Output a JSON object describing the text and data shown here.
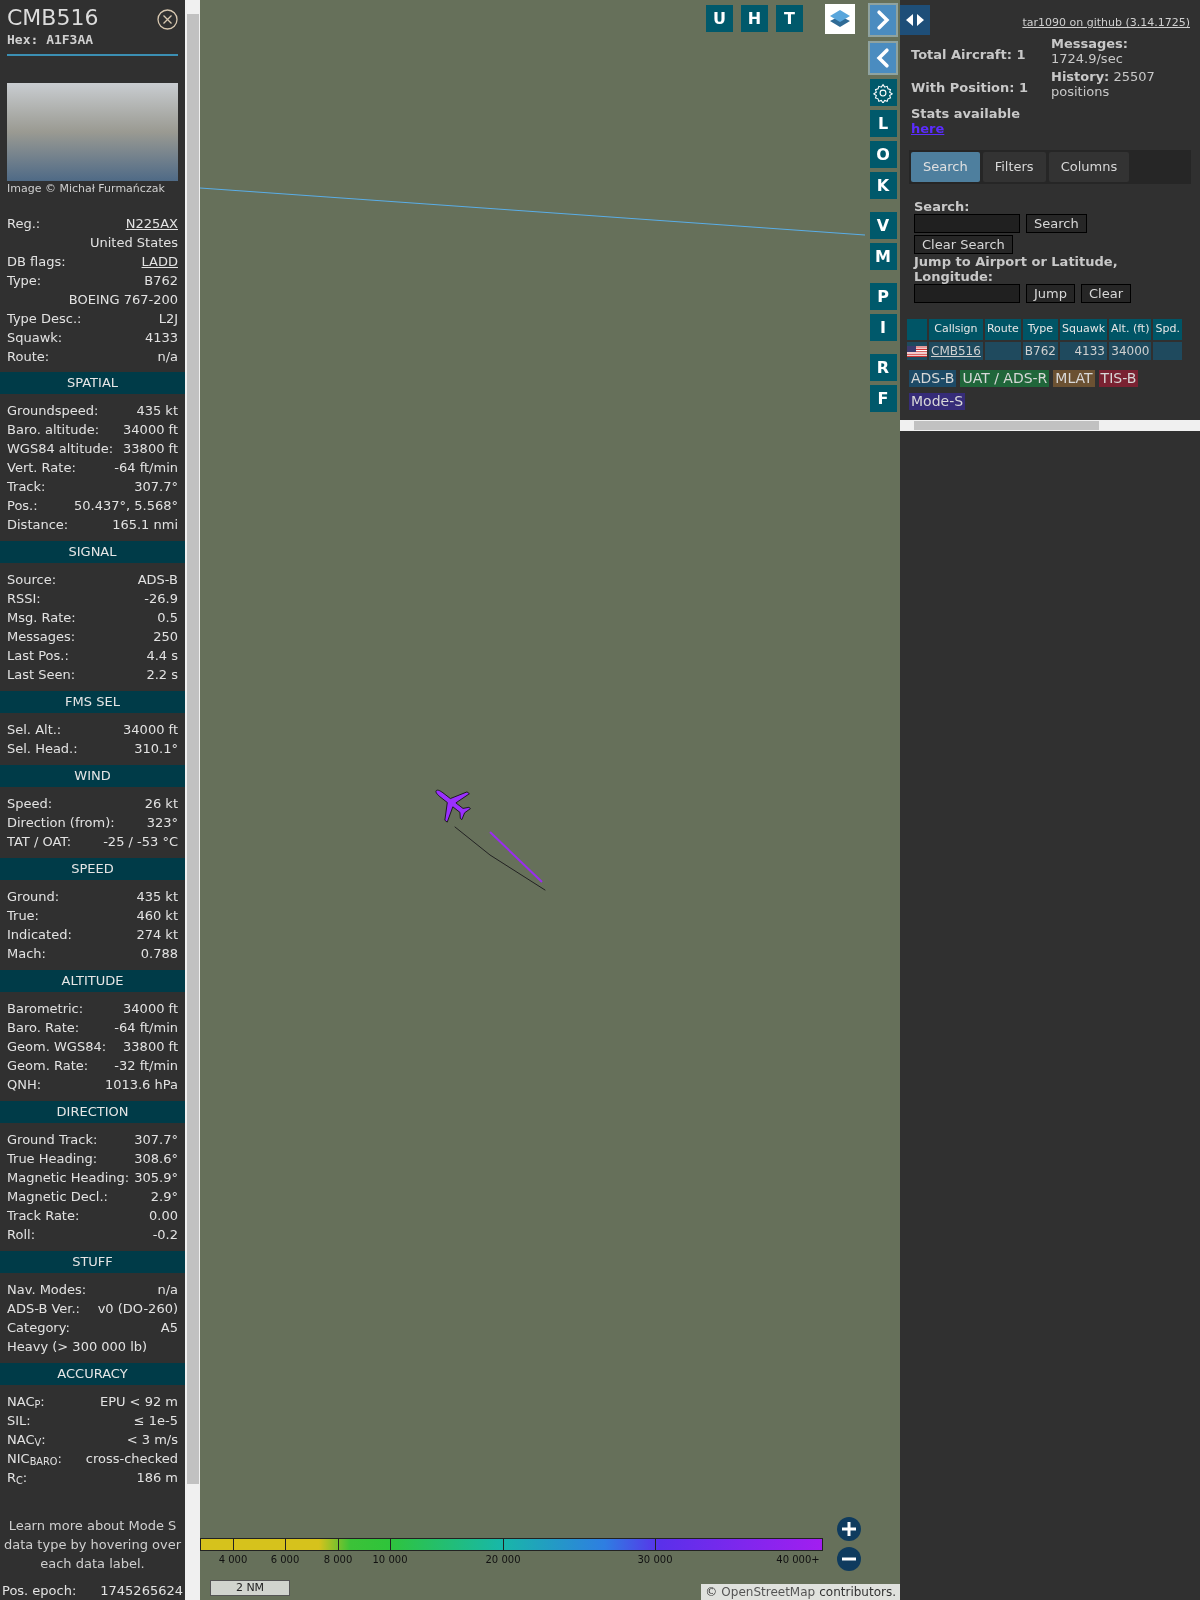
{
  "detail_panel": {
    "callsign": "CMB516",
    "hex": "Hex: A1F3AA",
    "photo_credit": "Image © Michał Furmańczak",
    "info_rows": [
      {
        "kind": "link_pair",
        "label": "Reg.:",
        "value": "N225AX"
      },
      {
        "kind": "value",
        "value": "United States"
      },
      {
        "kind": "link_pair",
        "label": "DB flags:",
        "value": "LADD"
      },
      {
        "kind": "pair",
        "label": "Type:",
        "value": "B762"
      },
      {
        "kind": "value",
        "value": "BOEING 767-200"
      },
      {
        "kind": "pair",
        "label": "Type Desc.:",
        "value": "L2J"
      },
      {
        "kind": "pair",
        "label": "Squawk:",
        "value": "4133"
      },
      {
        "kind": "pair",
        "label": "Route:",
        "value": "n/a"
      }
    ],
    "sections": [
      {
        "title": "SPATIAL",
        "rows": [
          {
            "kind": "pair",
            "label": "Groundspeed:",
            "value": "435 kt"
          },
          {
            "kind": "pair",
            "label": "Baro. altitude:",
            "value": "34000 ft"
          },
          {
            "kind": "pair",
            "label": "WGS84 altitude:",
            "value": "33800 ft"
          },
          {
            "kind": "pair",
            "label": "Vert. Rate:",
            "value": "-64 ft/min"
          },
          {
            "kind": "pair",
            "label": "Track:",
            "value": "307.7°"
          },
          {
            "kind": "pair",
            "label": "Pos.:",
            "value": "50.437°, 5.568°"
          },
          {
            "kind": "pair",
            "label": "Distance:",
            "value": "165.1 nmi"
          }
        ]
      },
      {
        "title": "SIGNAL",
        "rows": [
          {
            "kind": "pair",
            "label": "Source:",
            "value": "ADS-B"
          },
          {
            "kind": "pair",
            "label": "RSSI:",
            "value": "-26.9"
          },
          {
            "kind": "pair",
            "label": "Msg. Rate:",
            "value": "0.5"
          },
          {
            "kind": "pair",
            "label": "Messages:",
            "value": "250"
          },
          {
            "kind": "pair",
            "label": "Last Pos.:",
            "value": "4.4 s"
          },
          {
            "kind": "pair",
            "label": "Last Seen:",
            "value": "2.2 s"
          }
        ]
      },
      {
        "title": "FMS SEL",
        "rows": [
          {
            "kind": "pair",
            "label": "Sel. Alt.:",
            "value": "34000 ft"
          },
          {
            "kind": "pair",
            "label": "Sel. Head.:",
            "value": "310.1°"
          }
        ]
      },
      {
        "title": "WIND",
        "rows": [
          {
            "kind": "pair",
            "label": "Speed:",
            "value": "26 kt"
          },
          {
            "kind": "pair",
            "label": "Direction (from):",
            "value": "323°"
          },
          {
            "kind": "pair",
            "label": "TAT / OAT:",
            "value": "-25 / -53 °C"
          }
        ]
      },
      {
        "title": "SPEED",
        "rows": [
          {
            "kind": "pair",
            "label": "Ground:",
            "value": "435 kt"
          },
          {
            "kind": "pair",
            "label": "True:",
            "value": "460 kt"
          },
          {
            "kind": "pair",
            "label": "Indicated:",
            "value": "274 kt"
          },
          {
            "kind": "pair",
            "label": "Mach:",
            "value": "0.788"
          }
        ]
      },
      {
        "title": "ALTITUDE",
        "rows": [
          {
            "kind": "pair",
            "label": "Barometric:",
            "value": "34000 ft"
          },
          {
            "kind": "pair",
            "label": "Baro. Rate:",
            "value": "-64 ft/min"
          },
          {
            "kind": "pair",
            "label": "Geom. WGS84:",
            "value": "33800 ft"
          },
          {
            "kind": "pair",
            "label": "Geom. Rate:",
            "value": "-32 ft/min"
          },
          {
            "kind": "pair",
            "label": "QNH:",
            "value": "1013.6 hPa"
          }
        ]
      },
      {
        "title": "DIRECTION",
        "rows": [
          {
            "kind": "pair",
            "label": "Ground Track:",
            "value": "307.7°"
          },
          {
            "kind": "pair",
            "label": "True Heading:",
            "value": "308.6°"
          },
          {
            "kind": "pair",
            "label": "Magnetic Heading:",
            "value": "305.9°"
          },
          {
            "kind": "pair",
            "label": "Magnetic Decl.:",
            "value": "2.9°"
          },
          {
            "kind": "pair",
            "label": "Track Rate:",
            "value": "0.00"
          },
          {
            "kind": "pair",
            "label": "Roll:",
            "value": "-0.2"
          }
        ]
      },
      {
        "title": "STUFF",
        "rows": [
          {
            "kind": "pair",
            "label": "Nav. Modes:",
            "value": "n/a"
          },
          {
            "kind": "pair",
            "label": "ADS-B Ver.:",
            "value": "v0 (DO-260)"
          },
          {
            "kind": "pair",
            "label": "Category:",
            "value": "A5"
          },
          {
            "kind": "text",
            "value": "Heavy (> 300 000 lb)"
          }
        ]
      },
      {
        "title": "ACCURACY",
        "rows": [
          {
            "kind": "pair",
            "label": "NAC$_{P}$:",
            "value": "EPU < 92 m"
          },
          {
            "kind": "pair",
            "label": "SIL:",
            "value": "≤ 1e-5"
          },
          {
            "kind": "pair",
            "label": "NAC$_{V}$:",
            "value": "< 3 m/s"
          },
          {
            "kind": "pair",
            "label": "NIC$_{BARO}$:",
            "value": "cross-checked"
          },
          {
            "kind": "pair",
            "label": "R$_{C}$:",
            "value": "186 m"
          }
        ]
      }
    ],
    "help_note": "Learn more about Mode S data type by hovering over each data label.",
    "epoch": {
      "label": "Pos. epoch:",
      "value": "1745265624"
    }
  },
  "map": {
    "top_buttons": [
      "U",
      "H",
      "T"
    ],
    "nav_groups": [
      [
        {
          "kind": "next"
        },
        {
          "kind": "prev"
        },
        {
          "kind": "settings"
        },
        {
          "kind": "letter",
          "label": "L"
        },
        {
          "kind": "letter",
          "label": "O"
        },
        {
          "kind": "letter",
          "label": "K"
        }
      ],
      [
        {
          "kind": "letter",
          "label": "V"
        },
        {
          "kind": "letter",
          "label": "M"
        }
      ],
      [
        {
          "kind": "letter",
          "label": "P"
        },
        {
          "kind": "letter",
          "label": "I"
        }
      ],
      [
        {
          "kind": "letter",
          "label": "R"
        },
        {
          "kind": "letter",
          "label": "F"
        }
      ]
    ],
    "altitude_legend": [
      "4 000",
      "6 000",
      "8 000",
      "10 000",
      "20 000",
      "30 000",
      "40 000+"
    ],
    "scale": "2 NM",
    "attribution": {
      "prefix": "©",
      "link": "OpenStreetMap",
      "suffix": "contributors."
    }
  },
  "right_panel": {
    "github_link": "tar1090 on github (3.14.1725)",
    "stats": [
      {
        "label": "Total Aircraft:",
        "value": "1"
      },
      {
        "label": "With Position:",
        "value": "1"
      }
    ],
    "messages": {
      "label": "Messages:",
      "value": "1724.9/sec"
    },
    "history": {
      "label": "History:",
      "value": "25507 positions"
    },
    "stats_text": "Stats available",
    "stats_link": "here",
    "tabs": [
      {
        "label": "Search",
        "selected": true
      },
      {
        "label": "Filters",
        "selected": false
      },
      {
        "label": "Columns",
        "selected": false
      }
    ],
    "search": {
      "label": "Search:",
      "button": "Search",
      "clear_button": "Clear Search"
    },
    "jump": {
      "label": "Jump to Airport or Latitude, Longitude:",
      "buttons": [
        "Jump",
        "Clear"
      ]
    },
    "table": {
      "columns": [
        "Callsign",
        "Route",
        "Type",
        "Squawk",
        "Alt. (ft)",
        "Spd."
      ],
      "rows": [
        {
          "cells": [
            "CMB516",
            null,
            "B762",
            "4133",
            "34000",
            null
          ]
        }
      ]
    },
    "sources": [
      {
        "label": "ADS-B",
        "color": "#1d4a66"
      },
      {
        "label": "UAT / ADS-R",
        "color": "#20663a"
      },
      {
        "label": "MLAT",
        "color": "#6b5132"
      },
      {
        "label": "TIS-B",
        "color": "#7a2232"
      },
      {
        "label": "Mode-S",
        "color": "#362c78"
      }
    ]
  }
}
